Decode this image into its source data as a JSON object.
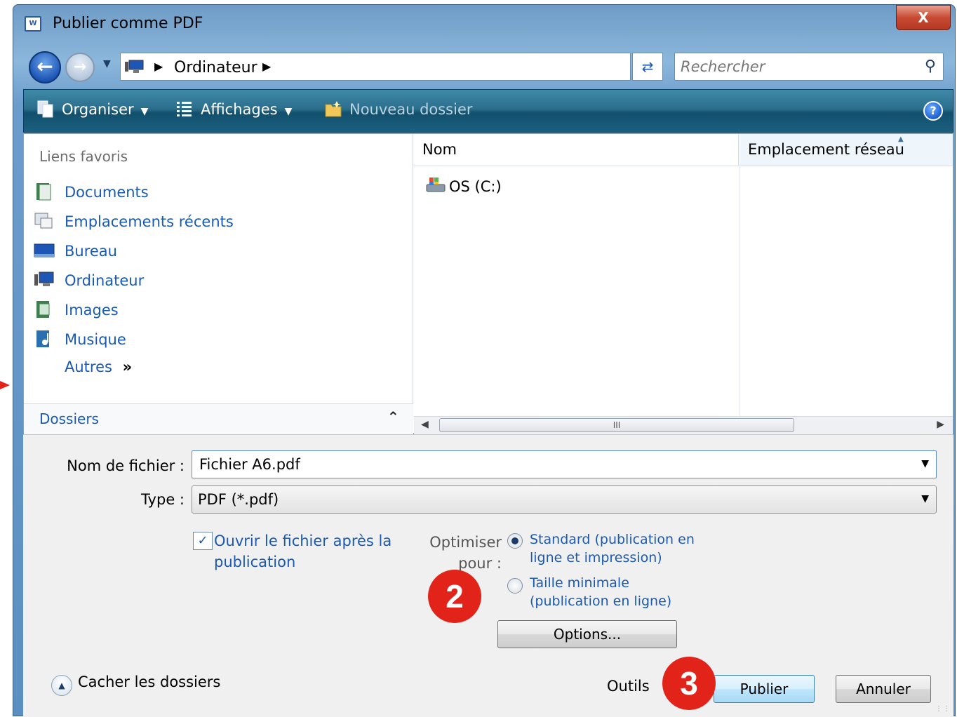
{
  "window": {
    "title": "Publier comme PDF",
    "close_label": "X"
  },
  "nav": {
    "breadcrumb": [
      "Ordinateur"
    ],
    "search_placeholder": "Rechercher"
  },
  "toolbar": {
    "organize": "Organiser",
    "views": "Affichages",
    "new_folder": "Nouveau dossier",
    "help": "?"
  },
  "sidebar": {
    "header": "Liens favoris",
    "items": [
      {
        "label": "Documents",
        "icon": "documents-icon"
      },
      {
        "label": "Emplacements récents",
        "icon": "recent-places-icon"
      },
      {
        "label": "Bureau",
        "icon": "desktop-icon"
      },
      {
        "label": "Ordinateur",
        "icon": "computer-icon"
      },
      {
        "label": "Images",
        "icon": "pictures-icon"
      },
      {
        "label": "Musique",
        "icon": "music-icon"
      },
      {
        "label": "Autres",
        "suffix": "»"
      }
    ],
    "folders_label": "Dossiers"
  },
  "files": {
    "columns": [
      "Nom",
      "Emplacement réseau"
    ],
    "rows": [
      {
        "name": "OS (C:)",
        "icon": "drive-icon"
      }
    ],
    "scroll_thumb": "III"
  },
  "form": {
    "filename_label": "Nom de fichier :",
    "filename_value": "Fichier A6.pdf",
    "type_label": "Type :",
    "type_value": "PDF (*.pdf)",
    "open_after_label": "Ouvrir le fichier après la publication",
    "open_after_checked": true,
    "optimize_label": "Optimiser pour :",
    "opt_standard": "Standard (publication en ligne et impression)",
    "opt_minimal": "Taille minimale (publication en ligne)",
    "selected_option": "standard",
    "options_button": "Options...",
    "hide_folders": "Cacher les dossiers",
    "tools": "Outils",
    "publish_button": "Publier",
    "cancel_button": "Annuler"
  },
  "annotations": {
    "badge_2": "2",
    "badge_3": "3",
    "badge_color": "#e2231a"
  },
  "colors": {
    "link": "#1a5ab4",
    "toolbar": "#1b5f7e",
    "accent": "#1e56b6"
  }
}
